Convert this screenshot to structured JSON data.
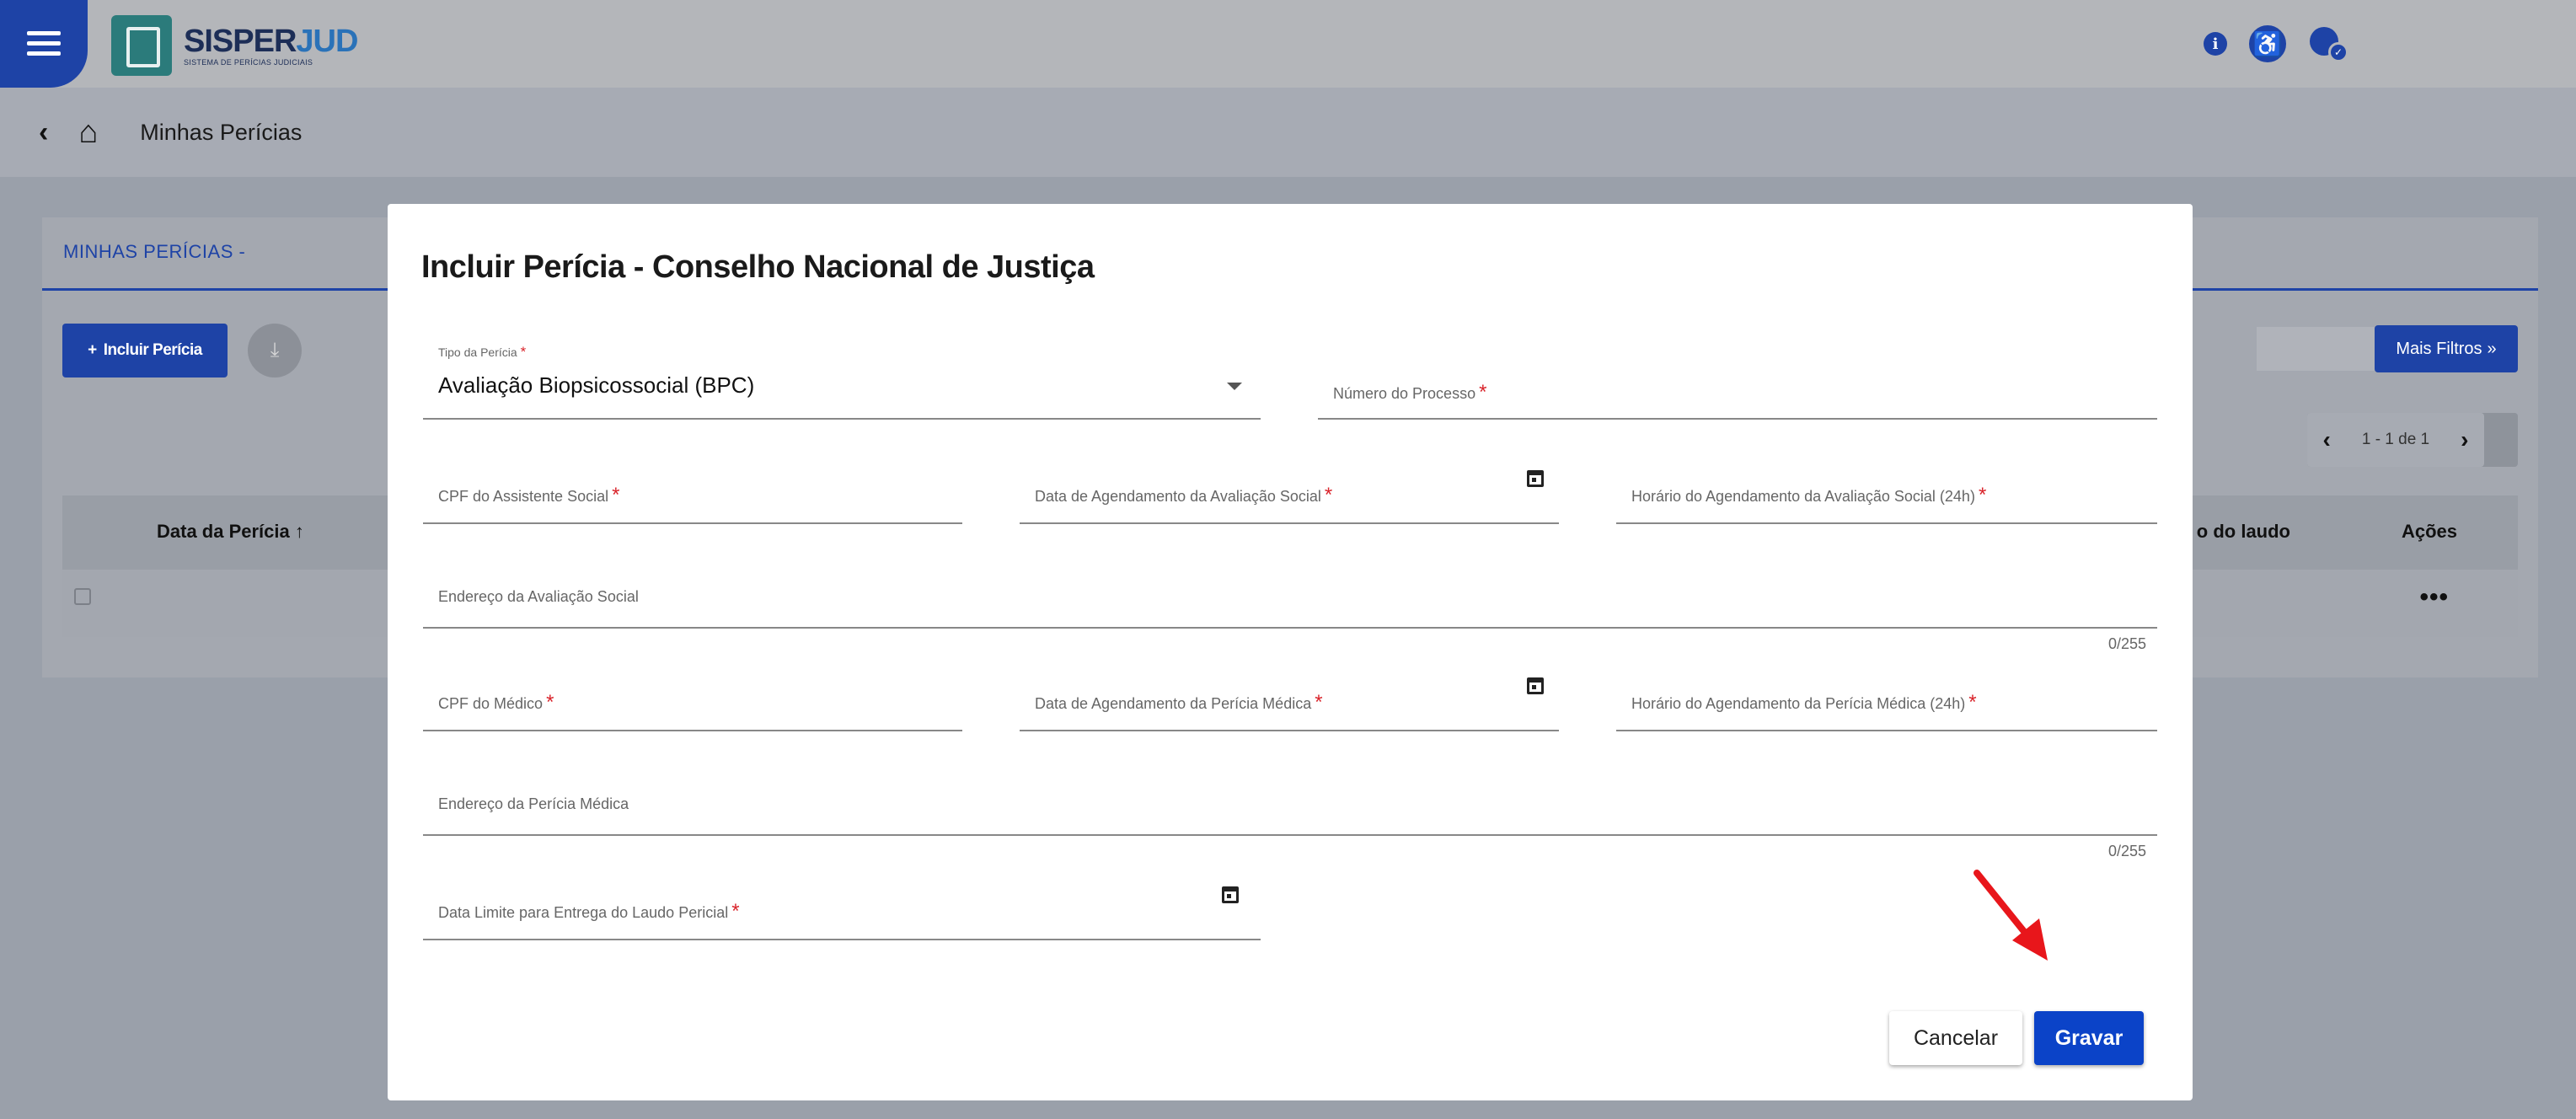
{
  "app": {
    "logo_title_a": "SISPER",
    "logo_title_b": "JUD",
    "logo_subtitle": "SISTEMA DE PERÍCIAS JUDICIAIS",
    "brand_color": "#1e43a6"
  },
  "header_icons": [
    "info-icon",
    "accessibility-icon",
    "user-verified-icon"
  ],
  "breadcrumb": {
    "title": "Minhas Perícias"
  },
  "list_page": {
    "tab_label": "MINHAS PERÍCIAS -",
    "add_button": "Incluir Perícia",
    "filters_button": "Mais Filtros",
    "pagination_text": "1 - 1 de 1",
    "columns": {
      "date": "Data da Perícia",
      "report": "o do laudo",
      "actions": "Ações"
    },
    "row_actions": "•••"
  },
  "modal": {
    "title": "Incluir Perícia - Conselho Nacional de Justiça",
    "tipo_pericia": {
      "label": "Tipo da Perícia",
      "value": "Avaliação Biopsicossocial (BPC)"
    },
    "numero_processo": {
      "label": "Número do Processo"
    },
    "cpf_assistente": {
      "label": "CPF do Assistente Social"
    },
    "data_avaliacao_social": {
      "label": "Data de Agendamento da Avaliação Social"
    },
    "horario_avaliacao_social": {
      "label": "Horário do Agendamento da Avaliação Social (24h)"
    },
    "endereco_avaliacao_social": {
      "label": "Endereço da Avaliação Social",
      "counter": "0/255"
    },
    "cpf_medico": {
      "label": "CPF do Médico"
    },
    "data_pericia_medica": {
      "label": "Data de Agendamento da Perícia Médica"
    },
    "horario_pericia_medica": {
      "label": "Horário do Agendamento da Perícia Médica (24h)"
    },
    "endereco_pericia_medica": {
      "label": "Endereço da Perícia Médica",
      "counter": "0/255"
    },
    "data_limite_laudo": {
      "label": "Data Limite para Entrega do Laudo Pericial"
    },
    "required_mark": "*",
    "cancel_button": "Cancelar",
    "save_button": "Gravar"
  },
  "annotation_color": "#e8161b"
}
